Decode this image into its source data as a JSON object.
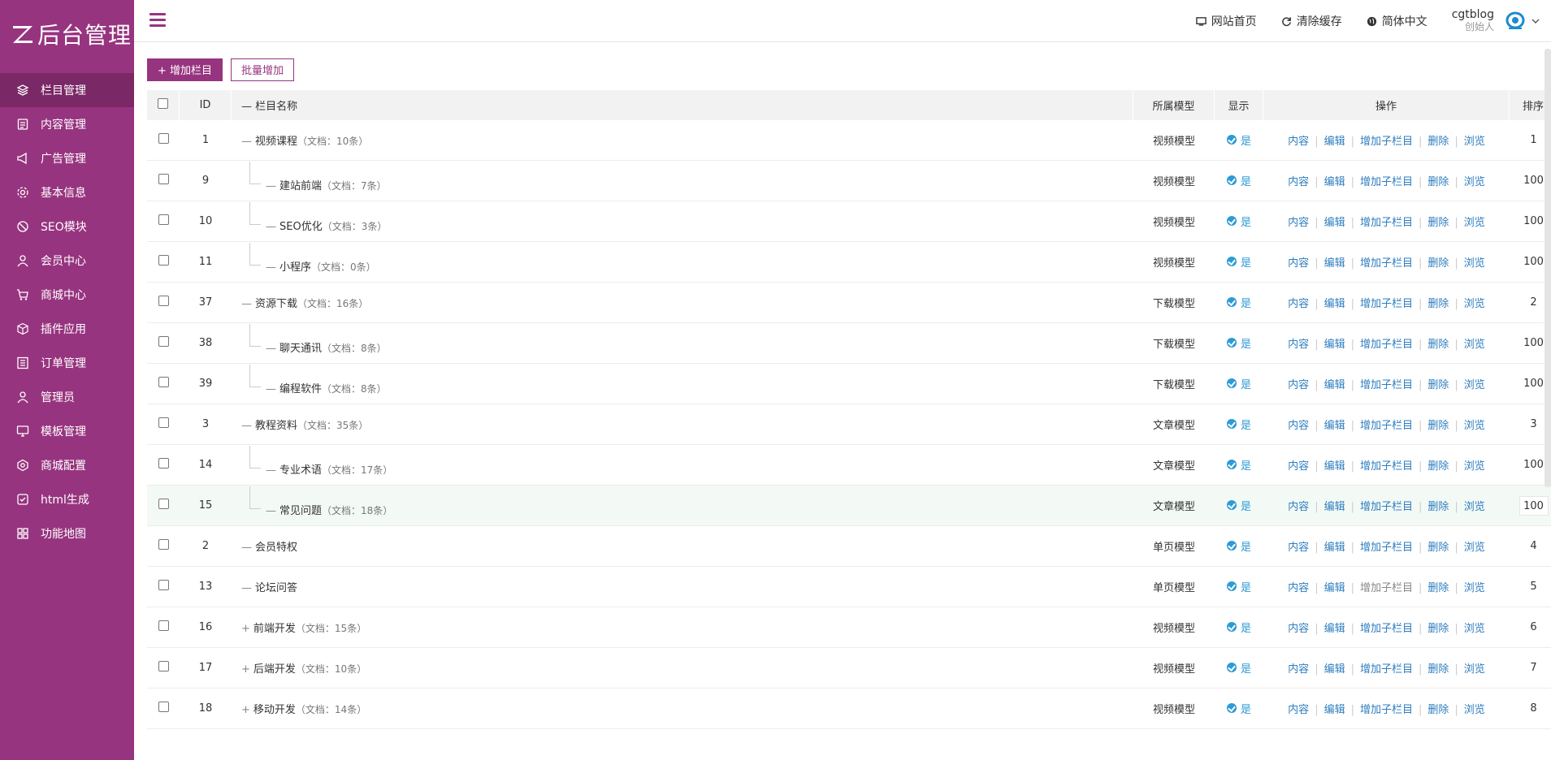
{
  "brand": {
    "logo_text": "后台管理",
    "accent": "#97347f"
  },
  "sidebar": {
    "items": [
      {
        "label": "栏目管理",
        "icon": "layers-icon",
        "active": true
      },
      {
        "label": "内容管理",
        "icon": "document-icon"
      },
      {
        "label": "广告管理",
        "icon": "megaphone-icon"
      },
      {
        "label": "基本信息",
        "icon": "gear-icon"
      },
      {
        "label": "SEO模块",
        "icon": "seo-icon"
      },
      {
        "label": "会员中心",
        "icon": "user-icon"
      },
      {
        "label": "商城中心",
        "icon": "cart-icon"
      },
      {
        "label": "插件应用",
        "icon": "cube-icon"
      },
      {
        "label": "订单管理",
        "icon": "list-icon"
      },
      {
        "label": "管理员",
        "icon": "admin-icon"
      },
      {
        "label": "模板管理",
        "icon": "monitor-icon"
      },
      {
        "label": "商城配置",
        "icon": "settings-hex-icon"
      },
      {
        "label": "html生成",
        "icon": "check-box-icon"
      },
      {
        "label": "功能地图",
        "icon": "grid-icon"
      }
    ]
  },
  "topbar": {
    "home": "网站首页",
    "clear_cache": "清除缓存",
    "language": "简体中文",
    "user_name": "cgtblog",
    "user_role": "创始人"
  },
  "toolbar": {
    "add": "+ 增加栏目",
    "batch_add": "批量增加"
  },
  "table": {
    "headers": {
      "id": "ID",
      "name": "— 栏目名称",
      "model": "所属模型",
      "display": "显示",
      "ops": "操作",
      "sort": "排序"
    },
    "ops": {
      "content": "内容",
      "edit": "编辑",
      "add_sub": "增加子栏目",
      "delete": "删除",
      "browse": "浏览"
    },
    "display_yes": "是",
    "rows": [
      {
        "id": "1",
        "level": 0,
        "prefix": "—",
        "name": "视频课程",
        "docs": "（文档：10条）",
        "model": "视频模型",
        "sort": "1"
      },
      {
        "id": "9",
        "level": 1,
        "prefix": "—",
        "name": "建站前端",
        "docs": "（文档：7条）",
        "model": "视频模型",
        "sort": "100"
      },
      {
        "id": "10",
        "level": 1,
        "prefix": "—",
        "name": "SEO优化",
        "docs": "（文档：3条）",
        "model": "视频模型",
        "sort": "100"
      },
      {
        "id": "11",
        "level": 1,
        "prefix": "—",
        "name": "小程序",
        "docs": "（文档：0条）",
        "model": "视频模型",
        "sort": "100"
      },
      {
        "id": "37",
        "level": 0,
        "prefix": "—",
        "name": "资源下载",
        "docs": "（文档：16条）",
        "model": "下载模型",
        "sort": "2"
      },
      {
        "id": "38",
        "level": 1,
        "prefix": "—",
        "name": "聊天通讯",
        "docs": "（文档：8条）",
        "model": "下载模型",
        "sort": "100"
      },
      {
        "id": "39",
        "level": 1,
        "prefix": "—",
        "name": "编程软件",
        "docs": "（文档：8条）",
        "model": "下载模型",
        "sort": "100"
      },
      {
        "id": "3",
        "level": 0,
        "prefix": "—",
        "name": "教程资料",
        "docs": "（文档：35条）",
        "model": "文章模型",
        "sort": "3"
      },
      {
        "id": "14",
        "level": 1,
        "prefix": "—",
        "name": "专业术语",
        "docs": "（文档：17条）",
        "model": "文章模型",
        "sort": "100"
      },
      {
        "id": "15",
        "level": 1,
        "prefix": "—",
        "name": "常见问题",
        "docs": "（文档：18条）",
        "model": "文章模型",
        "sort": "100",
        "highlight": true
      },
      {
        "id": "2",
        "level": 0,
        "prefix": "—",
        "name": "会员特权",
        "docs": "",
        "model": "单页模型",
        "sort": "4"
      },
      {
        "id": "13",
        "level": 0,
        "prefix": "—",
        "name": "论坛问答",
        "docs": "",
        "model": "单页模型",
        "sort": "5",
        "add_sub_disabled": true
      },
      {
        "id": "16",
        "level": 0,
        "prefix": "+",
        "name": "前端开发",
        "docs": "（文档：15条）",
        "model": "视频模型",
        "sort": "6"
      },
      {
        "id": "17",
        "level": 0,
        "prefix": "+",
        "name": "后端开发",
        "docs": "（文档：10条）",
        "model": "视频模型",
        "sort": "7"
      },
      {
        "id": "18",
        "level": 0,
        "prefix": "+",
        "name": "移动开发",
        "docs": "（文档：14条）",
        "model": "视频模型",
        "sort": "8"
      }
    ]
  }
}
